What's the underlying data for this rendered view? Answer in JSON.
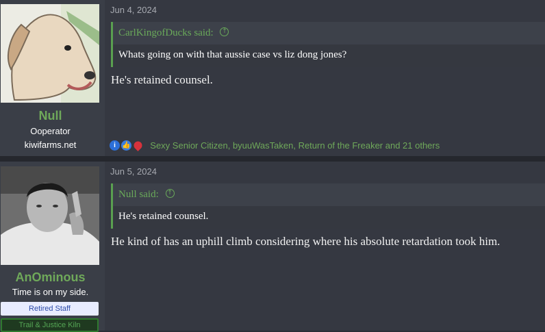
{
  "posts": [
    {
      "date": "Jun 4, 2024",
      "user": {
        "name": "Null",
        "title": "Ooperator",
        "subtitle": "kiwifarms.net"
      },
      "quote": {
        "author": "CarlKingofDucks said:",
        "text": "Whats going on with that aussie case vs liz dong jones?"
      },
      "body": "He's retained counsel.",
      "reactions": {
        "icons": [
          "informative-icon",
          "like-icon",
          "heart-icon"
        ],
        "text": "Sexy Senior Citizen, byuuWasTaken, Return of the Freaker and 21 others"
      }
    },
    {
      "date": "Jun 5, 2024",
      "user": {
        "name": "AnOminous",
        "title": "Time is on my side.",
        "banner_staff": "Retired Staff",
        "banner_truth": "Trail & Justice Kiln"
      },
      "quote": {
        "author": "Null said:",
        "text": "He's retained counsel."
      },
      "body": "He kind of has an uphill climb considering where his absolute retardation took him."
    }
  ],
  "colors": {
    "accent_green": "#6fa95a",
    "background": "#353841",
    "sidebar": "#3a3e47"
  }
}
